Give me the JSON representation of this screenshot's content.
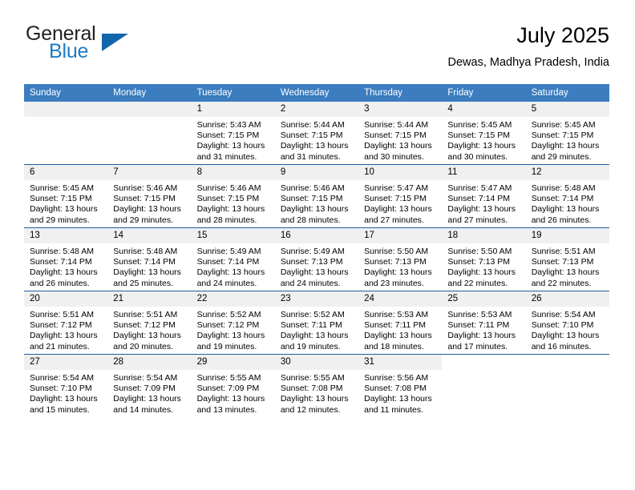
{
  "brand": {
    "word_general": "General",
    "word_blue": "Blue",
    "triangle_color": "#1266ac",
    "blue_color": "#1d7cc4"
  },
  "header": {
    "title": "July 2025",
    "subtitle": "Dewas, Madhya Pradesh, India"
  },
  "theme": {
    "header_background": "#3b7dbf",
    "row_border": "#1f5fa0",
    "daystrip_background": "#f0f0f0",
    "text_color": "#000000"
  },
  "weekday_headers": [
    "Sunday",
    "Monday",
    "Tuesday",
    "Wednesday",
    "Thursday",
    "Friday",
    "Saturday"
  ],
  "weeks": [
    [
      {
        "day": "",
        "sunrise": "",
        "sunset": "",
        "daylight": "",
        "empty": true
      },
      {
        "day": "",
        "sunrise": "",
        "sunset": "",
        "daylight": "",
        "empty": true
      },
      {
        "day": "1",
        "sunrise": "Sunrise: 5:43 AM",
        "sunset": "Sunset: 7:15 PM",
        "daylight": "Daylight: 13 hours and 31 minutes."
      },
      {
        "day": "2",
        "sunrise": "Sunrise: 5:44 AM",
        "sunset": "Sunset: 7:15 PM",
        "daylight": "Daylight: 13 hours and 31 minutes."
      },
      {
        "day": "3",
        "sunrise": "Sunrise: 5:44 AM",
        "sunset": "Sunset: 7:15 PM",
        "daylight": "Daylight: 13 hours and 30 minutes."
      },
      {
        "day": "4",
        "sunrise": "Sunrise: 5:45 AM",
        "sunset": "Sunset: 7:15 PM",
        "daylight": "Daylight: 13 hours and 30 minutes."
      },
      {
        "day": "5",
        "sunrise": "Sunrise: 5:45 AM",
        "sunset": "Sunset: 7:15 PM",
        "daylight": "Daylight: 13 hours and 29 minutes."
      }
    ],
    [
      {
        "day": "6",
        "sunrise": "Sunrise: 5:45 AM",
        "sunset": "Sunset: 7:15 PM",
        "daylight": "Daylight: 13 hours and 29 minutes."
      },
      {
        "day": "7",
        "sunrise": "Sunrise: 5:46 AM",
        "sunset": "Sunset: 7:15 PM",
        "daylight": "Daylight: 13 hours and 29 minutes."
      },
      {
        "day": "8",
        "sunrise": "Sunrise: 5:46 AM",
        "sunset": "Sunset: 7:15 PM",
        "daylight": "Daylight: 13 hours and 28 minutes."
      },
      {
        "day": "9",
        "sunrise": "Sunrise: 5:46 AM",
        "sunset": "Sunset: 7:15 PM",
        "daylight": "Daylight: 13 hours and 28 minutes."
      },
      {
        "day": "10",
        "sunrise": "Sunrise: 5:47 AM",
        "sunset": "Sunset: 7:15 PM",
        "daylight": "Daylight: 13 hours and 27 minutes."
      },
      {
        "day": "11",
        "sunrise": "Sunrise: 5:47 AM",
        "sunset": "Sunset: 7:14 PM",
        "daylight": "Daylight: 13 hours and 27 minutes."
      },
      {
        "day": "12",
        "sunrise": "Sunrise: 5:48 AM",
        "sunset": "Sunset: 7:14 PM",
        "daylight": "Daylight: 13 hours and 26 minutes."
      }
    ],
    [
      {
        "day": "13",
        "sunrise": "Sunrise: 5:48 AM",
        "sunset": "Sunset: 7:14 PM",
        "daylight": "Daylight: 13 hours and 26 minutes."
      },
      {
        "day": "14",
        "sunrise": "Sunrise: 5:48 AM",
        "sunset": "Sunset: 7:14 PM",
        "daylight": "Daylight: 13 hours and 25 minutes."
      },
      {
        "day": "15",
        "sunrise": "Sunrise: 5:49 AM",
        "sunset": "Sunset: 7:14 PM",
        "daylight": "Daylight: 13 hours and 24 minutes."
      },
      {
        "day": "16",
        "sunrise": "Sunrise: 5:49 AM",
        "sunset": "Sunset: 7:13 PM",
        "daylight": "Daylight: 13 hours and 24 minutes."
      },
      {
        "day": "17",
        "sunrise": "Sunrise: 5:50 AM",
        "sunset": "Sunset: 7:13 PM",
        "daylight": "Daylight: 13 hours and 23 minutes."
      },
      {
        "day": "18",
        "sunrise": "Sunrise: 5:50 AM",
        "sunset": "Sunset: 7:13 PM",
        "daylight": "Daylight: 13 hours and 22 minutes."
      },
      {
        "day": "19",
        "sunrise": "Sunrise: 5:51 AM",
        "sunset": "Sunset: 7:13 PM",
        "daylight": "Daylight: 13 hours and 22 minutes."
      }
    ],
    [
      {
        "day": "20",
        "sunrise": "Sunrise: 5:51 AM",
        "sunset": "Sunset: 7:12 PM",
        "daylight": "Daylight: 13 hours and 21 minutes."
      },
      {
        "day": "21",
        "sunrise": "Sunrise: 5:51 AM",
        "sunset": "Sunset: 7:12 PM",
        "daylight": "Daylight: 13 hours and 20 minutes."
      },
      {
        "day": "22",
        "sunrise": "Sunrise: 5:52 AM",
        "sunset": "Sunset: 7:12 PM",
        "daylight": "Daylight: 13 hours and 19 minutes."
      },
      {
        "day": "23",
        "sunrise": "Sunrise: 5:52 AM",
        "sunset": "Sunset: 7:11 PM",
        "daylight": "Daylight: 13 hours and 19 minutes."
      },
      {
        "day": "24",
        "sunrise": "Sunrise: 5:53 AM",
        "sunset": "Sunset: 7:11 PM",
        "daylight": "Daylight: 13 hours and 18 minutes."
      },
      {
        "day": "25",
        "sunrise": "Sunrise: 5:53 AM",
        "sunset": "Sunset: 7:11 PM",
        "daylight": "Daylight: 13 hours and 17 minutes."
      },
      {
        "day": "26",
        "sunrise": "Sunrise: 5:54 AM",
        "sunset": "Sunset: 7:10 PM",
        "daylight": "Daylight: 13 hours and 16 minutes."
      }
    ],
    [
      {
        "day": "27",
        "sunrise": "Sunrise: 5:54 AM",
        "sunset": "Sunset: 7:10 PM",
        "daylight": "Daylight: 13 hours and 15 minutes."
      },
      {
        "day": "28",
        "sunrise": "Sunrise: 5:54 AM",
        "sunset": "Sunset: 7:09 PM",
        "daylight": "Daylight: 13 hours and 14 minutes."
      },
      {
        "day": "29",
        "sunrise": "Sunrise: 5:55 AM",
        "sunset": "Sunset: 7:09 PM",
        "daylight": "Daylight: 13 hours and 13 minutes."
      },
      {
        "day": "30",
        "sunrise": "Sunrise: 5:55 AM",
        "sunset": "Sunset: 7:08 PM",
        "daylight": "Daylight: 13 hours and 12 minutes."
      },
      {
        "day": "31",
        "sunrise": "Sunrise: 5:56 AM",
        "sunset": "Sunset: 7:08 PM",
        "daylight": "Daylight: 13 hours and 11 minutes."
      },
      {
        "day": "",
        "sunrise": "",
        "sunset": "",
        "daylight": "",
        "blank": true
      },
      {
        "day": "",
        "sunrise": "",
        "sunset": "",
        "daylight": "",
        "blank": true
      }
    ]
  ]
}
